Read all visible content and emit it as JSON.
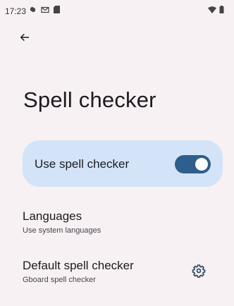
{
  "status": {
    "time": "17:23",
    "icons_left": [
      "settings-icon",
      "gmail-icon",
      "sd-card-icon"
    ],
    "icons_right": [
      "wifi-icon",
      "battery-icon"
    ]
  },
  "header": {
    "back_icon": "arrow-left-icon",
    "title": "Spell checker"
  },
  "toggle": {
    "label": "Use spell checker",
    "checked": true,
    "accent": "#2e5e8b",
    "card_color": "#d3e4f8"
  },
  "items": [
    {
      "title": "Languages",
      "subtitle": "Use system languages"
    },
    {
      "title": "Default spell checker",
      "subtitle": "Gboard spell checker",
      "icon": "gear-icon"
    }
  ]
}
